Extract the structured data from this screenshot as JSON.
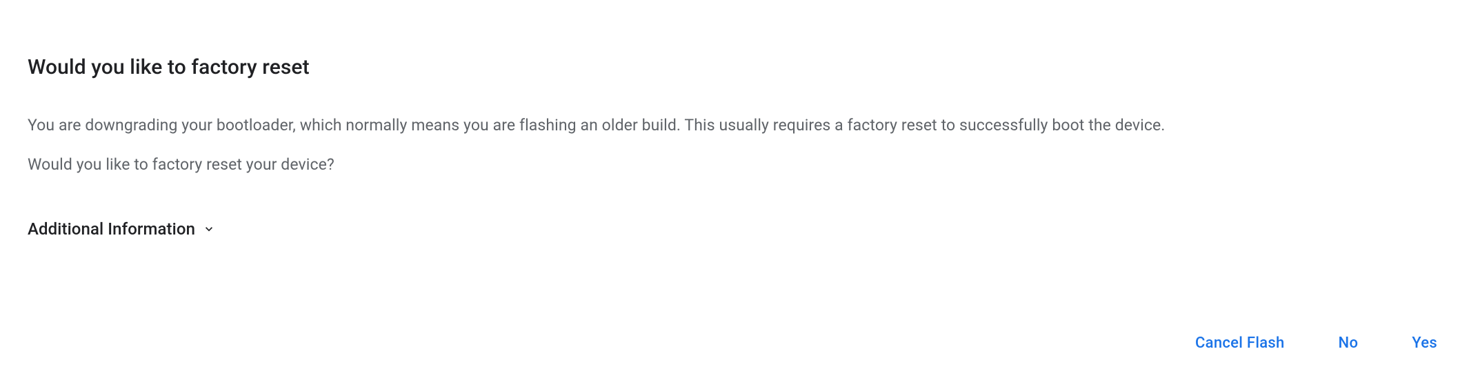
{
  "dialog": {
    "title": "Would you like to factory reset",
    "body_line1": "You are downgrading your bootloader, which normally means you are flashing an older build. This usually requires a factory reset to successfully boot the device.",
    "body_line2": "Would you like to factory reset your device?",
    "expandable_label": "Additional Information"
  },
  "buttons": {
    "cancel": "Cancel Flash",
    "no": "No",
    "yes": "Yes"
  }
}
